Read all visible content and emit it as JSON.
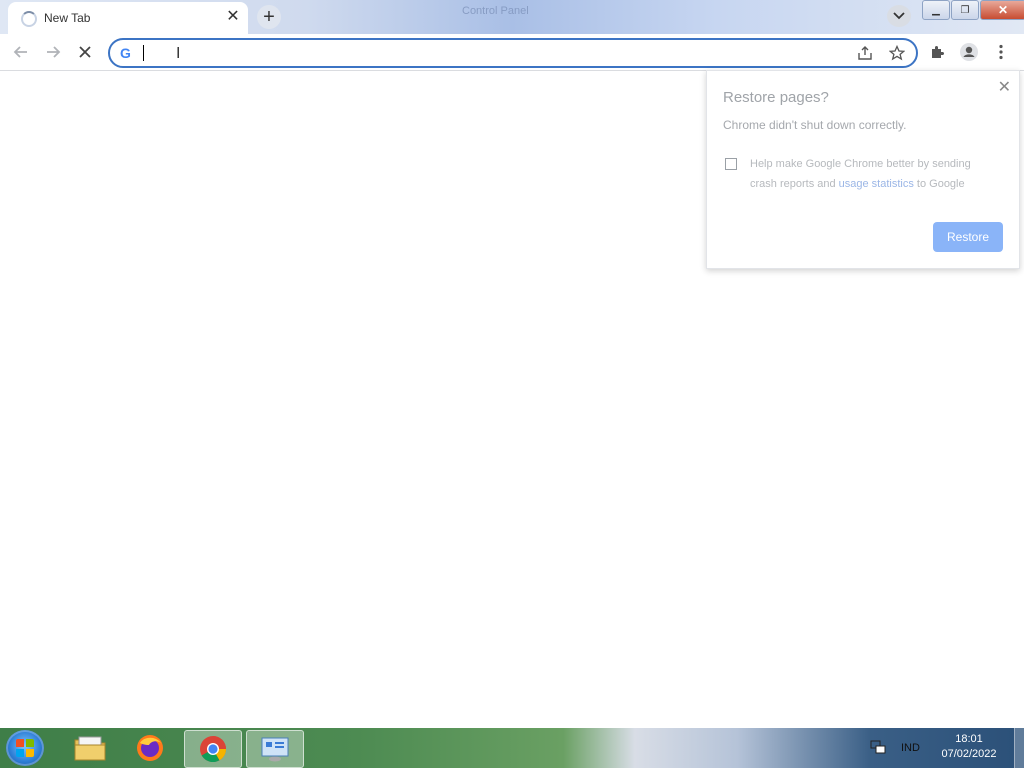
{
  "tab": {
    "title": "New Tab"
  },
  "titlebar": {
    "faint_label": "Control Panel"
  },
  "omnibox": {
    "value": "",
    "placeholder": ""
  },
  "restore": {
    "title": "Restore pages?",
    "message": "Chrome didn't shut down correctly.",
    "help_prefix": "Help make Google Chrome better by sending crash reports and ",
    "help_link": "usage statistics",
    "help_suffix": " to Google",
    "button": "Restore"
  },
  "taskbar": {
    "language": "IND",
    "time": "18:01",
    "date": "07/02/2022"
  },
  "colors": {
    "omnibox_border": "#3c74c4",
    "restore_button": "#8ab4f8",
    "link": "#9bb6e6"
  }
}
